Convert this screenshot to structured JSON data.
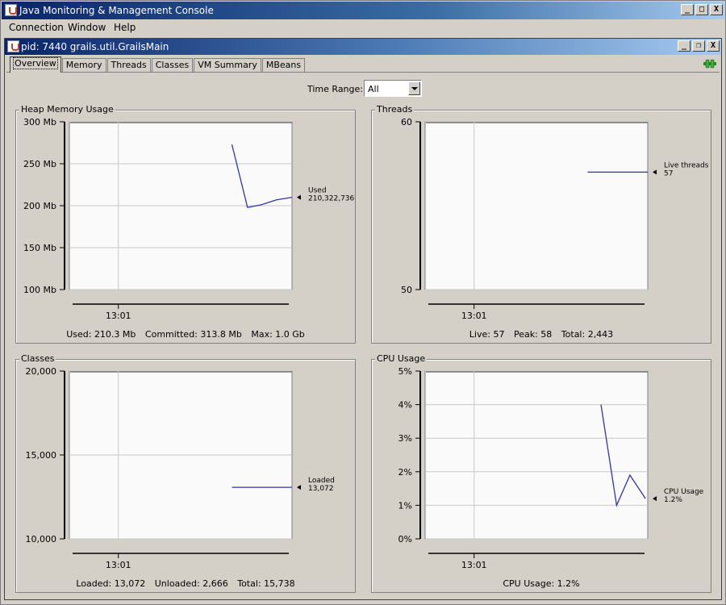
{
  "window": {
    "title": "Java Monitoring & Management Console",
    "buttons": [
      "_",
      "□",
      "X"
    ]
  },
  "menu": [
    "Connection",
    "Window",
    "Help"
  ],
  "inner_window": {
    "title": "pid: 7440 grails.util.GrailsMain",
    "buttons": [
      "_",
      "❐",
      "X"
    ]
  },
  "tabs": [
    {
      "label": "Overview",
      "active": true
    },
    {
      "label": "Memory",
      "active": false
    },
    {
      "label": "Threads",
      "active": false
    },
    {
      "label": "Classes",
      "active": false
    },
    {
      "label": "VM Summary",
      "active": false
    },
    {
      "label": "MBeans",
      "active": false
    }
  ],
  "time_range": {
    "label": "Time Range:",
    "value": "All"
  },
  "panels": {
    "heap": {
      "title": "Heap Memory Usage",
      "stats": [
        "Used: 210.3 Mb",
        "Committed: 313.8 Mb",
        "Max: 1.0 Gb"
      ]
    },
    "threads": {
      "title": "Threads",
      "stats": [
        "Live: 57",
        "Peak: 58",
        "Total: 2,443"
      ]
    },
    "classes": {
      "title": "Classes",
      "stats": [
        "Loaded: 13,072",
        "Unloaded: 2,666",
        "Total: 15,738"
      ]
    },
    "cpu": {
      "title": "CPU Usage",
      "stats": [
        "CPU Usage: 1.2%"
      ]
    }
  },
  "colors": {
    "line": "#3333b0",
    "titlebar": "#0a246a",
    "plot_bg": "#fafafa"
  },
  "chart_data": [
    {
      "type": "line",
      "id": "heap",
      "yticks": [
        {
          "v": 100,
          "label": "100 Mb"
        },
        {
          "v": 150,
          "label": "150 Mb"
        },
        {
          "v": 200,
          "label": "200 Mb"
        },
        {
          "v": 250,
          "label": "250 Mb"
        },
        {
          "v": 300,
          "label": "300 Mb"
        }
      ],
      "ylim": [
        100,
        300
      ],
      "xlim": [
        0,
        1
      ],
      "xtick": {
        "v": 0.22,
        "label": "13:01"
      },
      "series": [
        {
          "name": "Used",
          "value_label": "210,322,736",
          "x": [
            0.73,
            0.8,
            0.86,
            0.93,
            1.0
          ],
          "y": [
            273,
            198,
            201,
            207,
            210
          ]
        }
      ]
    },
    {
      "type": "line",
      "id": "threads",
      "yticks": [
        {
          "v": 50,
          "label": "50"
        },
        {
          "v": 60,
          "label": "60"
        }
      ],
      "ylim": [
        50,
        60
      ],
      "xlim": [
        0,
        1
      ],
      "xtick": {
        "v": 0.22,
        "label": "13:01"
      },
      "series": [
        {
          "name": "Live threads",
          "value_label": "57",
          "x": [
            0.73,
            1.0
          ],
          "y": [
            57,
            57
          ]
        }
      ]
    },
    {
      "type": "line",
      "id": "classes",
      "yticks": [
        {
          "v": 10000,
          "label": "10,000"
        },
        {
          "v": 15000,
          "label": "15,000"
        },
        {
          "v": 20000,
          "label": "20,000"
        }
      ],
      "ylim": [
        10000,
        20000
      ],
      "xlim": [
        0,
        1
      ],
      "xtick": {
        "v": 0.22,
        "label": "13:01"
      },
      "series": [
        {
          "name": "Loaded",
          "value_label": "13,072",
          "x": [
            0.73,
            1.0
          ],
          "y": [
            13072,
            13072
          ]
        }
      ]
    },
    {
      "type": "line",
      "id": "cpu",
      "yticks": [
        {
          "v": 0,
          "label": "0%"
        },
        {
          "v": 1,
          "label": "1%"
        },
        {
          "v": 2,
          "label": "2%"
        },
        {
          "v": 3,
          "label": "3%"
        },
        {
          "v": 4,
          "label": "4%"
        },
        {
          "v": 5,
          "label": "5%"
        }
      ],
      "ylim": [
        0,
        5
      ],
      "xlim": [
        0,
        1
      ],
      "xtick": {
        "v": 0.22,
        "label": "13:01"
      },
      "series": [
        {
          "name": "CPU Usage",
          "value_label": "1.2%",
          "x": [
            0.79,
            0.86,
            0.92,
            0.99
          ],
          "y": [
            4.0,
            1.0,
            1.9,
            1.2
          ]
        }
      ]
    }
  ]
}
